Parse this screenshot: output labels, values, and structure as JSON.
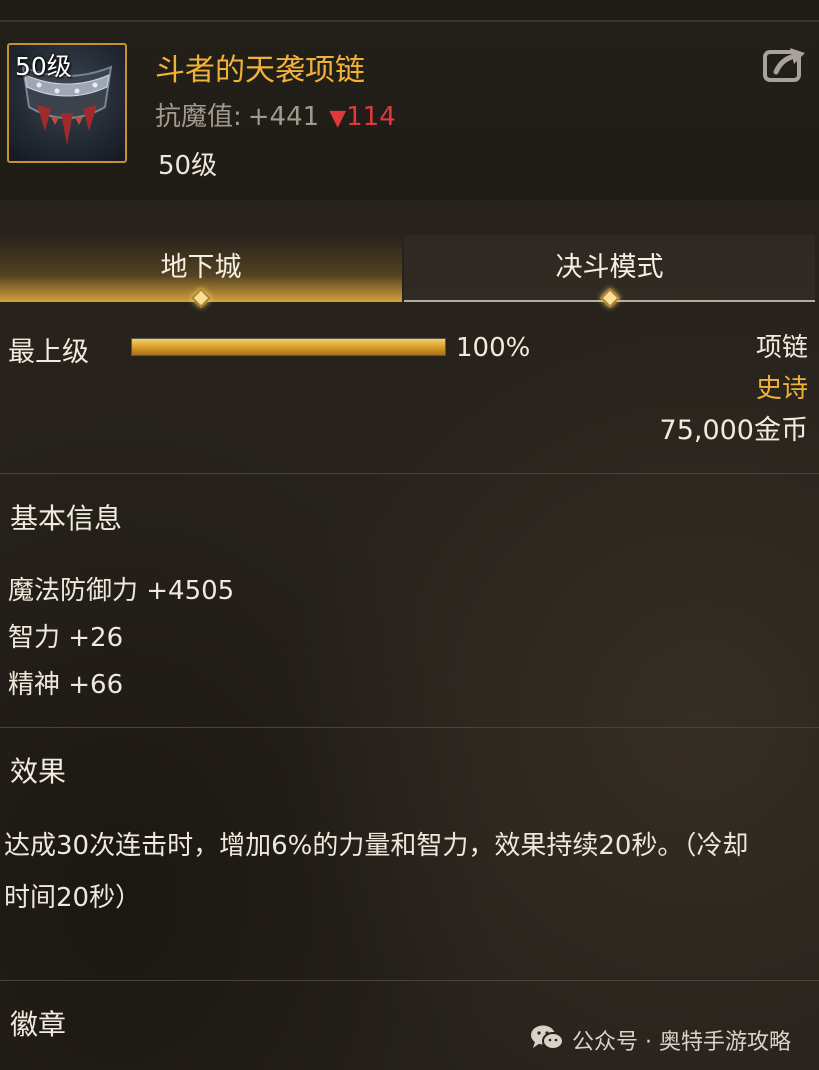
{
  "item": {
    "level_badge": "50级",
    "name": "斗者的天袭项链",
    "resist_label": "抗魔值:",
    "resist_value": "+441",
    "resist_down_symbol": "▼",
    "resist_down_value": "114",
    "level_text": "50级",
    "share_icon": "share-export-icon"
  },
  "tabs": [
    {
      "label": "地下城",
      "active": true
    },
    {
      "label": "决斗模式",
      "active": false
    }
  ],
  "grade": {
    "label": "最上级",
    "progress": 1.0,
    "percent_text": "100%"
  },
  "right_info": {
    "type": "项链",
    "rarity": "史诗",
    "price": "75,000金币"
  },
  "basic_info": {
    "title": "基本信息",
    "stats": [
      "魔法防御力 +4505",
      "智力 +26",
      "精神 +66"
    ]
  },
  "effect": {
    "title": "效果",
    "text": "达成30次连击时，增加6%的力量和智力，效果持续20秒。（冷却时间20秒）"
  },
  "badge": {
    "title": "徽章"
  },
  "watermark": {
    "text": "公众号 · 奥特手游攻略",
    "logo_icon": "wechat-logo-icon"
  },
  "colors": {
    "accent_gold": "#f0b238",
    "down_red": "#e0383c",
    "background": "#27221c"
  }
}
